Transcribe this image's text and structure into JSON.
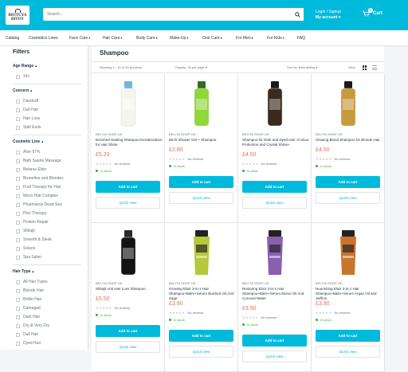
{
  "header": {
    "logo_text_top": "BIOTUYA",
    "logo_text_bottom": "BITOY",
    "search_placeholder": "Search...",
    "account_line1": "Login / Signup",
    "account_line2": "My account",
    "cart_label": "Cart",
    "cart_count": "0",
    "accent_color": "#00badb"
  },
  "nav": {
    "items": [
      {
        "label": "Catalog",
        "dropdown": false
      },
      {
        "label": "Cosmetics Lines",
        "dropdown": false
      },
      {
        "label": "Face Care",
        "dropdown": true
      },
      {
        "label": "Hair Care",
        "dropdown": true
      },
      {
        "label": "Body Care",
        "dropdown": true
      },
      {
        "label": "Make-Up",
        "dropdown": true
      },
      {
        "label": "Oral Care",
        "dropdown": true
      },
      {
        "label": "For Men",
        "dropdown": true
      },
      {
        "label": "For Kids",
        "dropdown": true
      },
      {
        "label": "FAQ",
        "dropdown": false
      }
    ]
  },
  "sidebar": {
    "title": "Filters",
    "age_range": {
      "title": "Age Range",
      "items": [
        "14+"
      ]
    },
    "concern": {
      "title": "Concern",
      "items": [
        "Dandruff",
        "Dull Hair",
        "Hair Loss",
        "Split Ends"
      ]
    },
    "cosmetic_line": {
      "title": "Cosmetic Line",
      "items": [
        "Aloe 97%",
        "Bath Sauna Massage",
        "Belarus Elixir",
        "Brunettes and Blondes",
        "Fruit Therapy for Hair",
        "Mezo Hair Complex",
        "Pharmacos Dead Sea",
        "Plex Therapy",
        "Protein Repair",
        "Shilajit",
        "Smooth & Sleek",
        "Solaris",
        "Spa Salon"
      ]
    },
    "hair_type": {
      "title": "Hair Type",
      "items": [
        "All Hair Types",
        "Blonde Hair",
        "Brittle Hair",
        "Damaged",
        "Dark Hair",
        "Dry & Very Dry",
        "Dull Hair",
        "Dyed Hair"
      ]
    }
  },
  "main": {
    "title": "Shampoo",
    "count_text": "Showing 1 - 20 of 20 products",
    "display_text": "Display: 36 per page",
    "sort_text": "Sort by: Best selling",
    "view_label": "View",
    "add_to_cart": "Add to cart",
    "quick_view": "Quick view",
    "in_stock": "In stock",
    "no_reviews": "No reviews",
    "products": [
      {
        "vendor": "BELITA SHOP UK",
        "name": "Enriched Healing Shampoo-Keratinization for Hair Shine",
        "price": "£5.20",
        "bottle_color": "#f4f4f0",
        "cap_color": "#6fb7e0",
        "icon": "white-bottle-image"
      },
      {
        "vendor": "BELITA SHOP UK",
        "name": "Birch Shower Gel + Shampoo",
        "price": "£2.80",
        "bottle_color": "#8ed839",
        "cap_color": "#2e6e1a",
        "icon": "green-bottle-image"
      },
      {
        "vendor": "BELITA SHOP UK",
        "name": "Shampoo for Dark and Dyed Hair «Colour Protection and Crystal Shine»",
        "price": "£4.50",
        "bottle_color": "#3a2a1e",
        "cap_color": "#1a1a1a",
        "icon": "dark-bottle-image"
      },
      {
        "vendor": "BELITA SHOP UK",
        "name": "Glowing Blond Shampoo for Blonde Hair",
        "price": "£4.50",
        "bottle_color": "#c79a3e",
        "cap_color": "#1a1a1a",
        "icon": "gold-bottle-image"
      },
      {
        "vendor": "BELITA SHOP UK",
        "name": "Shilajit Anti Hair Loss Shampoo",
        "price": "£5.50",
        "bottle_color": "#141414",
        "cap_color": "#2a2a2a",
        "icon": "black-bottle-image"
      },
      {
        "vendor": "BELITA SHOP UK",
        "name": "Growing Elixir 3-in-1 Hair Shampoo+Balm+Serum Burdock Oil And Sage",
        "price": "£3.90",
        "bottle_color": "#b5c93a",
        "cap_color": "#222222",
        "icon": "lime-tube-image"
      },
      {
        "vendor": "BELITA SHOP UK",
        "name": "Restoring Elixir 3-in-1 Hair Shampoo+Balm+Serum Monoi Oil And Coconut Water",
        "price": "£3.90",
        "bottle_color": "#8a5fb0",
        "cap_color": "#222222",
        "icon": "purple-tube-image"
      },
      {
        "vendor": "BELITA SHOP UK",
        "name": "Nourishing Elixir 3-in-1 Hair Shampoo+Balm+Serum Argan Oil and Saffron",
        "price": "£3.90",
        "bottle_color": "#c9742e",
        "cap_color": "#222222",
        "icon": "orange-tube-image"
      }
    ]
  }
}
